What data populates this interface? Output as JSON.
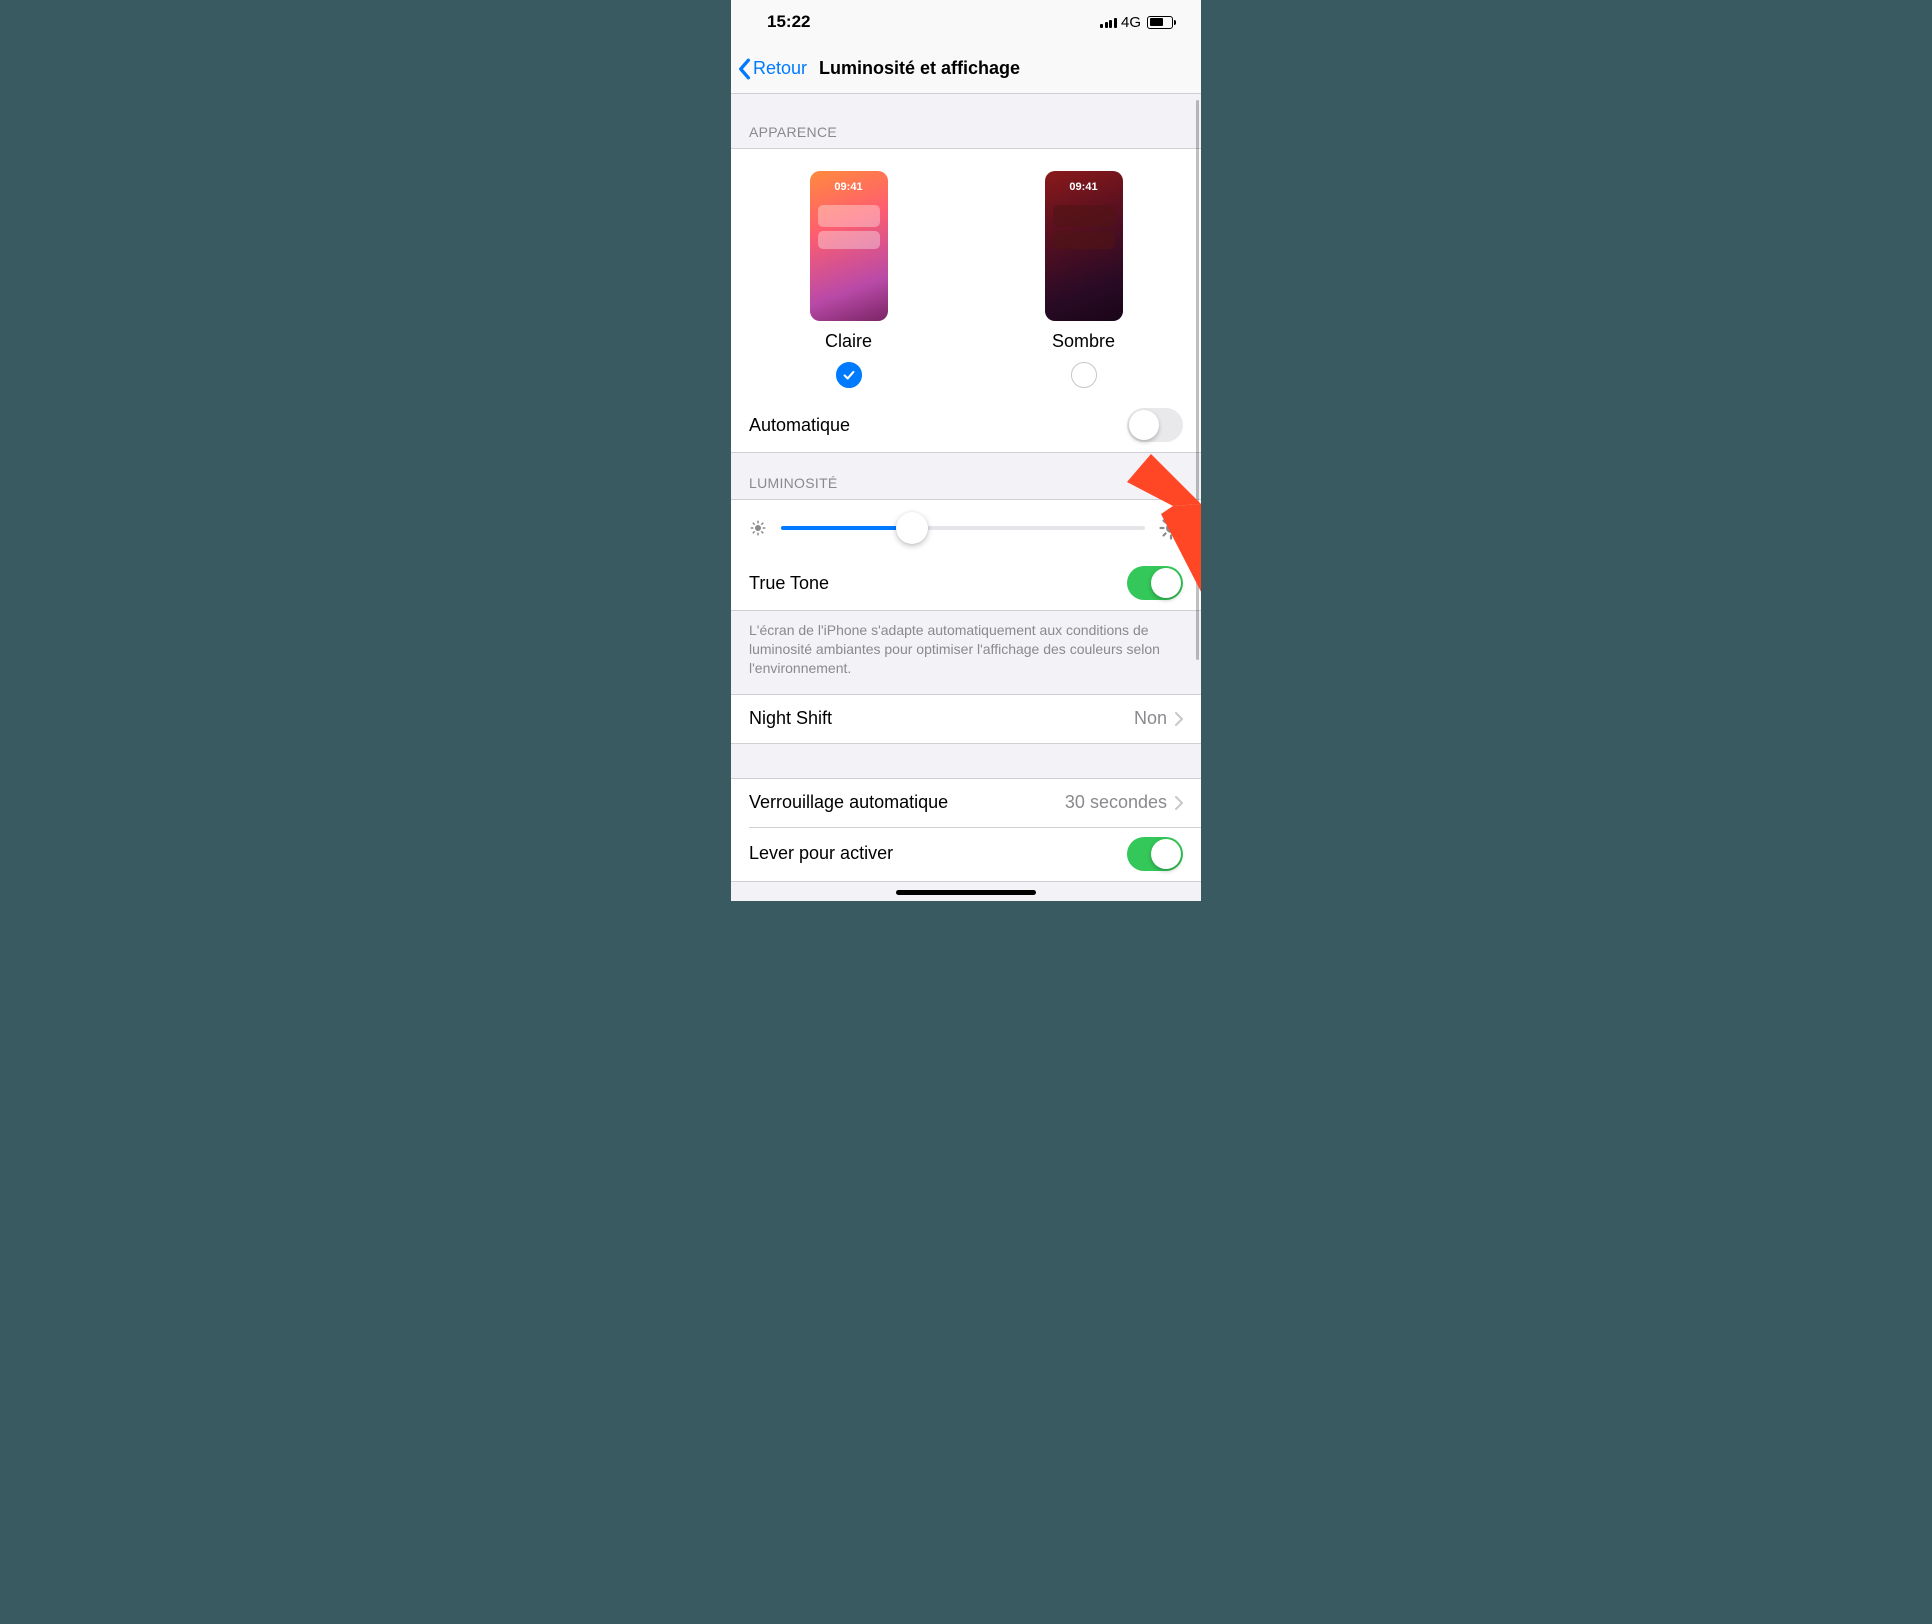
{
  "status": {
    "time": "15:22",
    "network_label": "4G"
  },
  "nav": {
    "back_label": "Retour",
    "title": "Luminosité et affichage"
  },
  "appearance": {
    "header": "APPARENCE",
    "preview_time": "09:41",
    "option_light_label": "Claire",
    "option_dark_label": "Sombre",
    "selected": "light",
    "automatic_label": "Automatique",
    "automatic_on": false
  },
  "brightness": {
    "header": "LUMINOSITÉ",
    "value_percent": 36,
    "true_tone_label": "True Tone",
    "true_tone_on": true,
    "true_tone_desc": "L'écran de l'iPhone s'adapte automatiquement aux conditions de luminosité ambiantes pour optimiser l'affichage des couleurs selon l'environnement."
  },
  "night_shift": {
    "label": "Night Shift",
    "value": "Non"
  },
  "auto_lock": {
    "label": "Verrouillage automatique",
    "value": "30 secondes"
  },
  "raise_to_wake": {
    "label": "Lever pour activer",
    "on": true
  },
  "colors": {
    "tint": "#007aff",
    "switch_on": "#34c759",
    "annotation": "#ff4726"
  }
}
